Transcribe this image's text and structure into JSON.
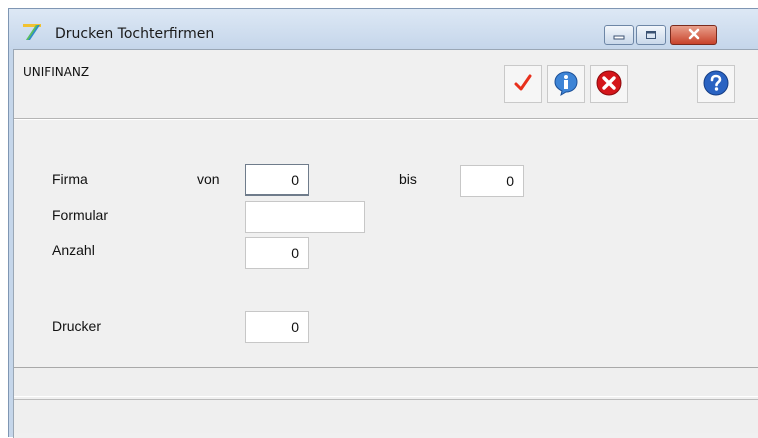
{
  "window": {
    "title": "Drucken Tochterfirmen",
    "icons": {
      "app": "pencil-app-icon",
      "minimize": "minimize-icon",
      "maximize": "maximize-icon",
      "close": "close-icon"
    }
  },
  "toolbar": {
    "company": "UNIFINANZ",
    "buttons": [
      {
        "name": "ok",
        "icon": "checkmark-icon",
        "color": "#e8301c"
      },
      {
        "name": "info",
        "icon": "info-icon",
        "color": "#2b6fc4"
      },
      {
        "name": "cancel",
        "icon": "cancel-x-icon",
        "color": "#d4161b"
      },
      {
        "name": "help",
        "icon": "help-question-icon",
        "color": "#2a63c2"
      }
    ]
  },
  "form": {
    "firma_label": "Firma",
    "von_label": "von",
    "bis_label": "bis",
    "firma_von": "0",
    "firma_bis": "0",
    "formular_label": "Formular",
    "formular_value": "",
    "anzahl_label": "Anzahl",
    "anzahl_value": "0",
    "drucker_label": "Drucker",
    "drucker_value": "0"
  },
  "status": {
    "line1": "",
    "line2": ""
  }
}
